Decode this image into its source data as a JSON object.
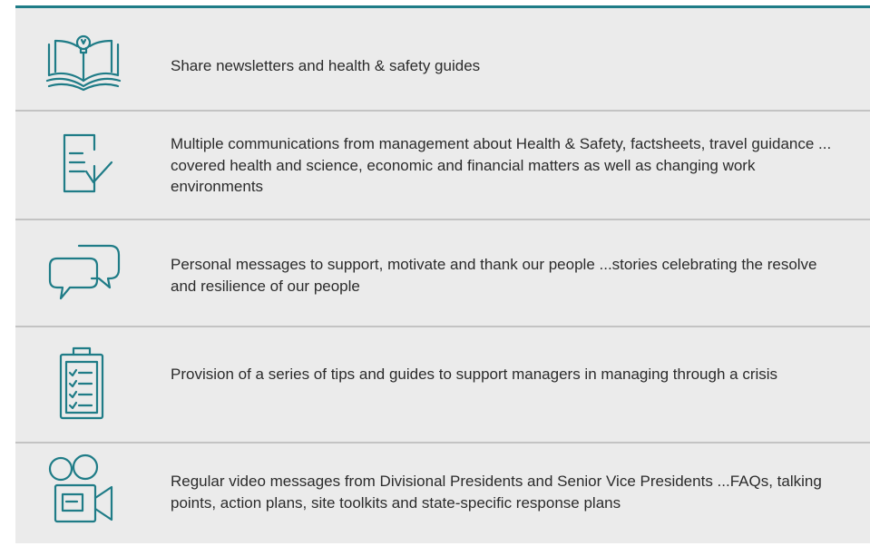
{
  "rows": [
    {
      "icon": "open-book-lightbulb-icon",
      "text": "Share newsletters and health & safety guides"
    },
    {
      "icon": "document-checkmark-icon",
      "text": "Multiple communications from management about Health & Safety, factsheets, travel guidance ... covered health and science, economic and financial matters as well as changing work environments"
    },
    {
      "icon": "speech-bubbles-icon",
      "text": "Personal messages to support, motivate and thank our people ...stories celebrating the resolve and resilience of our people"
    },
    {
      "icon": "clipboard-checklist-icon",
      "text": "Provision of a series of tips and guides to support managers in managing through a crisis"
    },
    {
      "icon": "video-camera-icon",
      "text": "Regular video messages from Divisional Presidents and Senior Vice Presidents ...FAQs, talking points, action plans, site toolkits and state-specific response plans"
    }
  ],
  "colors": {
    "accent": "#1f7c87",
    "panel_background": "#ebebeb",
    "divider": "#c3c3c3",
    "text": "#2b2b2b"
  }
}
